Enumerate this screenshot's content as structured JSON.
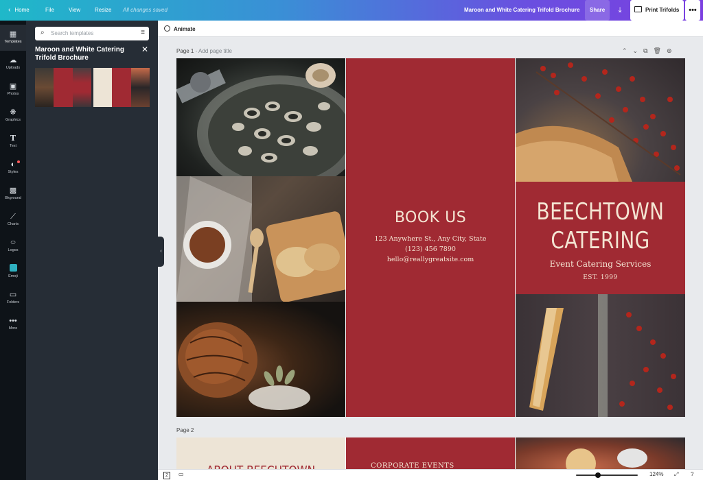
{
  "topbar": {
    "home": "Home",
    "file": "File",
    "view": "View",
    "resize": "Resize",
    "save_status": "All changes saved",
    "doc_title": "Maroon and White Catering Trifold Brochure",
    "share": "Share",
    "print": "Print Trifolds",
    "more": "•••"
  },
  "sidebar": {
    "items": [
      {
        "label": "Templates",
        "icon": "templates-icon"
      },
      {
        "label": "Uploads",
        "icon": "upload-cloud-icon"
      },
      {
        "label": "Photos",
        "icon": "photo-icon"
      },
      {
        "label": "Graphics",
        "icon": "shapes-icon"
      },
      {
        "label": "Text",
        "icon": "text-icon"
      },
      {
        "label": "Styles",
        "icon": "palette-icon"
      },
      {
        "label": "Bkground",
        "icon": "background-pattern-icon"
      },
      {
        "label": "Charts",
        "icon": "chart-line-icon"
      },
      {
        "label": "Logos",
        "icon": "logo-badge-icon"
      },
      {
        "label": "Emoji",
        "icon": "emoji-icon"
      },
      {
        "label": "Folders",
        "icon": "folder-icon"
      },
      {
        "label": "More",
        "icon": "more-dots-icon"
      }
    ]
  },
  "panel": {
    "search_placeholder": "Search templates",
    "title": "Maroon and White Catering Trifold Brochure"
  },
  "toolbar": {
    "animate": "Animate"
  },
  "page1": {
    "label": "Page 1",
    "add_title": "- Add page title"
  },
  "brochure": {
    "book_title": "BOOK US",
    "address": "123 Anywhere St., Any City, State",
    "phone": "(123) 456 7890",
    "email": "hello@reallygreatsite.com",
    "brand_line1": "BEECHTOWN",
    "brand_line2": "CATERING",
    "tagline": "Event Catering Services",
    "est": "EST. 1999"
  },
  "page2": {
    "label": "Page 2",
    "heading_partial": "ABOUT BEECHTOWN",
    "corporate": "CORPORATE EVENTS"
  },
  "bottombar": {
    "zoom": "124%",
    "zoom_level": 0.36,
    "page_count": "2"
  },
  "colors": {
    "maroon": "#a02a33",
    "cream": "#f4e5d3",
    "panel_bg": "#262d36",
    "rail_bg": "#0e1318"
  }
}
